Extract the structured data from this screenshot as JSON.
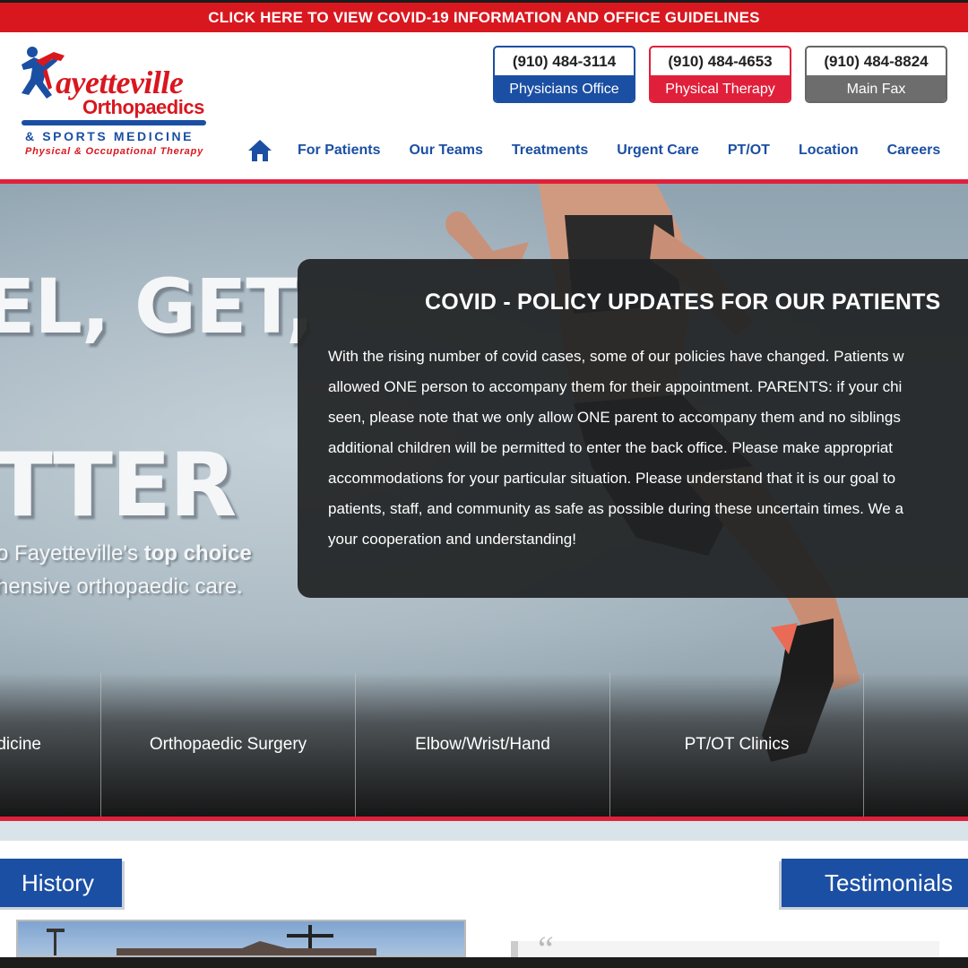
{
  "covid_banner": {
    "text": "CLICK HERE TO VIEW COVID-19 INFORMATION AND OFFICE GUIDELINES"
  },
  "logo": {
    "name_line1": "ayetteville",
    "name_line2": "Orthopaedics",
    "line3": "& SPORTS MEDICINE",
    "line4": "Physical & Occupational Therapy"
  },
  "phones": [
    {
      "number": "(910) 484-3114",
      "label": "Physicians Office",
      "color": "#1b4fa3"
    },
    {
      "number": "(910) 484-4653",
      "label": "Physical Therapy",
      "color": "#e0203b"
    },
    {
      "number": "(910) 484-8824",
      "label": "Main Fax",
      "color": "#6d6d6d"
    }
  ],
  "nav": {
    "home_icon": "home-icon",
    "items": [
      "For Patients",
      "Our Teams",
      "Treatments",
      "Urgent Care",
      "PT/OT",
      "Location",
      "Careers"
    ]
  },
  "hero": {
    "headline1": "EL, GET,",
    "headline2": "TTER",
    "sub_line1_prefix": "o Fayetteville's ",
    "sub_line1_bold": "top choice",
    "sub_line2": "hensive orthopaedic care."
  },
  "covid_modal": {
    "title": "COVID - POLICY UPDATES FOR OUR PATIENTS",
    "body_lines": [
      "With the rising number of covid cases, some of our policies have changed. Patients w",
      "allowed ONE person to accompany them for their appointment. PARENTS: if your chi",
      "seen, please note that we only allow ONE parent to accompany them and no siblings",
      "additional children will be permitted to enter the back office. Please make appropriat",
      "accommodations for your particular situation. Please understand that it is our goal to",
      "patients, staff, and community as safe as possible during these uncertain times. We a",
      "your cooperation and understanding!"
    ]
  },
  "services": [
    "dicine",
    "Orthopaedic Surgery",
    "Elbow/Wrist/Hand",
    "PT/OT Clinics",
    ""
  ],
  "lower": {
    "history_label": "History",
    "testimonials_label": "Testimonials"
  },
  "colors": {
    "brand_blue": "#1b4fa3",
    "brand_red": "#d9171f",
    "accent_red": "#e0203b"
  }
}
